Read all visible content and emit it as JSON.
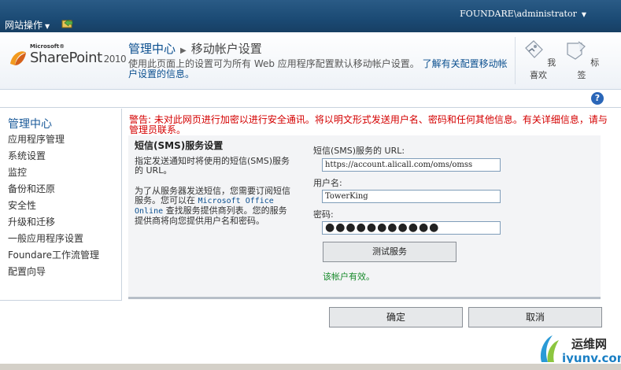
{
  "topbar": {
    "site_actions": "网站操作",
    "user": "FOUNDARE\\administrator"
  },
  "titlearea": {
    "logo_microsoft": "Microsoft®",
    "logo_product": "SharePoint",
    "logo_year": "2010",
    "breadcrumb_root": "管理中心",
    "breadcrumb_current": "移动帐户设置",
    "description": "使用此页面上的设置可为所有 Web 应用程序配置默认移动帐户设置。",
    "learn_more": "了解有关配置移动帐户设置的信息。",
    "like_label": "我喜欢",
    "tags_label": "标签"
  },
  "leftnav": {
    "header": "管理中心",
    "items": [
      "应用程序管理",
      "系统设置",
      "监控",
      "备份和还原",
      "安全性",
      "升级和迁移",
      "一般应用程序设置",
      "Foundare工作流管理",
      "配置向导"
    ]
  },
  "warning": "警告: 未对此网页进行加密以进行安全通讯。将以明文形式发送用户名、密码和任何其他信息。有关详细信息，请与管理员联系。",
  "section": {
    "title": "短信(SMS)服务设置",
    "desc1": "指定发送通知时将使用的短信(SMS)服务的 URL。",
    "desc2_a": "为了从服务器发送短信，您需要订阅短信服务。您可以在 ",
    "desc2_link": "Microsoft Office Online",
    "desc2_b": " 查找服务提供商列表。您的服务提供商将向您提供用户名和密码。"
  },
  "fields": {
    "url_label": "短信(SMS)服务的 URL:",
    "url_value": "https://account.alicall.com/oms/omss",
    "user_label": "用户名:",
    "user_value": "TowerKing",
    "password_label": "密码:",
    "password_value": "●●●●●●●●●●●",
    "test_button": "测试服务",
    "valid_message": "该帐户有效。"
  },
  "buttons": {
    "ok": "确定",
    "cancel": "取消"
  },
  "watermark": {
    "line1": "运维网",
    "line2": "iyunv.com"
  },
  "colors": {
    "topbar": "#1b4a74",
    "warning": "#d40000",
    "link": "#0b4f8f",
    "success": "#178a2b"
  }
}
